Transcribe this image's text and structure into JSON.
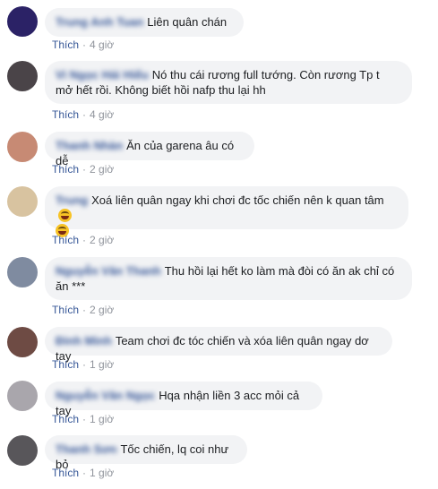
{
  "like_label": "Thích",
  "separator": "·",
  "comments": [
    {
      "author": "Trung Anh Tuan",
      "text": "Liên quân chán",
      "text_tail": "",
      "time": "4 giờ",
      "avatar_color": "#2b2266"
    },
    {
      "author": "Vi Ngọc Hải Hiếu",
      "text": "Nó thu cái rương full tướng. Còn rương Tp t",
      "text2": "mở hết rồi. Không biết hồi nafp thu lại hh",
      "time": "4 giờ",
      "avatar_color": "#4a4448"
    },
    {
      "author": "Thanh Nhàn",
      "text": "Ăn của garena âu có dễ",
      "time": "2 giờ",
      "avatar_color": "#c78a74"
    },
    {
      "author": "Trung",
      "text": "Xoá liên quân ngay khi chơi đc tốc chiến nên k quan tâm",
      "time": "2 giờ",
      "avatar_color": "#d8c3a0",
      "emoji": "laughing-emoji"
    },
    {
      "author": "Nguyễn Văn Thanh",
      "text": "Thu hồi lại hết ko làm mà đòi có ăn ak chỉ có",
      "text2": "ăn ***",
      "time": "2 giờ",
      "avatar_color": "#7f8ba0"
    },
    {
      "author": "Đinh Minh",
      "text": "Team chơi đc tóc chiến và xóa liên quân ngay dơ tay",
      "time": "1 giờ",
      "avatar_color": "#6e4b44"
    },
    {
      "author": "Nguyễn Văn Ngọc",
      "text": "Hqa nhận liền 3 acc mỏi cả tay",
      "time": "1 giờ",
      "avatar_color": "#a9a6ac"
    },
    {
      "author": "Thanh Sơn",
      "text": "Tốc chiến, lq coi như bỏ",
      "time": "1 giờ",
      "avatar_color": "#58565a"
    }
  ]
}
